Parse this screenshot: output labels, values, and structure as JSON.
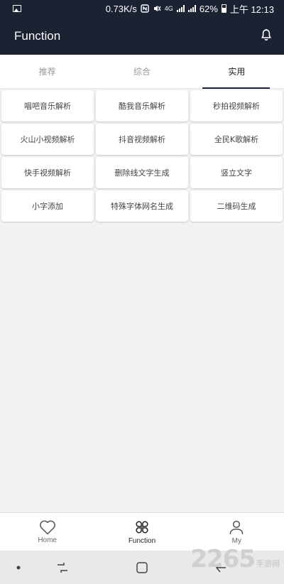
{
  "status_bar": {
    "speed": "0.73K/s",
    "network_type": "4G",
    "battery": "62%",
    "time": "上午 12:13"
  },
  "appbar": {
    "title": "Function"
  },
  "tabs": [
    {
      "label": "推荐",
      "active": false
    },
    {
      "label": "综合",
      "active": false
    },
    {
      "label": "实用",
      "active": true
    }
  ],
  "functions": [
    "唱吧音乐解析",
    "酷我音乐解析",
    "秒拍视频解析",
    "火山小视频解析",
    "抖音视频解析",
    "全民K歌解析",
    "快手视频解析",
    "删除线文字生成",
    "竖立文字",
    "小字添加",
    "特殊字体网名生成",
    "二维码生成"
  ],
  "bottom_nav": [
    {
      "label": "Home",
      "icon": "heart-icon",
      "active": false
    },
    {
      "label": "Function",
      "icon": "function-grid-icon",
      "active": true
    },
    {
      "label": "My",
      "icon": "person-icon",
      "active": false
    }
  ],
  "watermark": {
    "number": "2265",
    "text": "手游网"
  },
  "colors": {
    "header_bg": "#1b2232",
    "page_bg": "#f2f2f2",
    "card_bg": "#ffffff"
  }
}
